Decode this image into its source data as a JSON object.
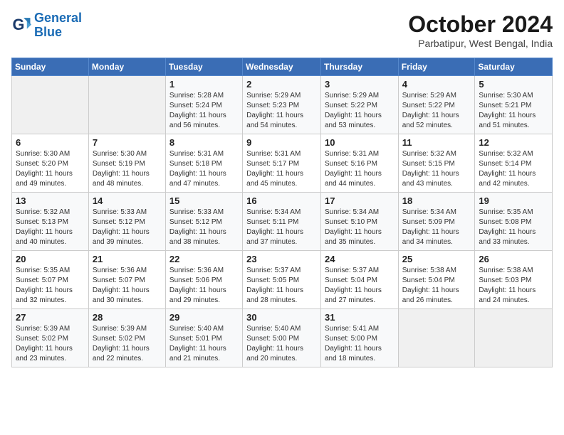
{
  "logo": {
    "line1": "General",
    "line2": "Blue"
  },
  "title": "October 2024",
  "location": "Parbatipur, West Bengal, India",
  "headers": [
    "Sunday",
    "Monday",
    "Tuesday",
    "Wednesday",
    "Thursday",
    "Friday",
    "Saturday"
  ],
  "weeks": [
    [
      {
        "day": "",
        "info": ""
      },
      {
        "day": "",
        "info": ""
      },
      {
        "day": "1",
        "info": "Sunrise: 5:28 AM\nSunset: 5:24 PM\nDaylight: 11 hours and 56 minutes."
      },
      {
        "day": "2",
        "info": "Sunrise: 5:29 AM\nSunset: 5:23 PM\nDaylight: 11 hours and 54 minutes."
      },
      {
        "day": "3",
        "info": "Sunrise: 5:29 AM\nSunset: 5:22 PM\nDaylight: 11 hours and 53 minutes."
      },
      {
        "day": "4",
        "info": "Sunrise: 5:29 AM\nSunset: 5:22 PM\nDaylight: 11 hours and 52 minutes."
      },
      {
        "day": "5",
        "info": "Sunrise: 5:30 AM\nSunset: 5:21 PM\nDaylight: 11 hours and 51 minutes."
      }
    ],
    [
      {
        "day": "6",
        "info": "Sunrise: 5:30 AM\nSunset: 5:20 PM\nDaylight: 11 hours and 49 minutes."
      },
      {
        "day": "7",
        "info": "Sunrise: 5:30 AM\nSunset: 5:19 PM\nDaylight: 11 hours and 48 minutes."
      },
      {
        "day": "8",
        "info": "Sunrise: 5:31 AM\nSunset: 5:18 PM\nDaylight: 11 hours and 47 minutes."
      },
      {
        "day": "9",
        "info": "Sunrise: 5:31 AM\nSunset: 5:17 PM\nDaylight: 11 hours and 45 minutes."
      },
      {
        "day": "10",
        "info": "Sunrise: 5:31 AM\nSunset: 5:16 PM\nDaylight: 11 hours and 44 minutes."
      },
      {
        "day": "11",
        "info": "Sunrise: 5:32 AM\nSunset: 5:15 PM\nDaylight: 11 hours and 43 minutes."
      },
      {
        "day": "12",
        "info": "Sunrise: 5:32 AM\nSunset: 5:14 PM\nDaylight: 11 hours and 42 minutes."
      }
    ],
    [
      {
        "day": "13",
        "info": "Sunrise: 5:32 AM\nSunset: 5:13 PM\nDaylight: 11 hours and 40 minutes."
      },
      {
        "day": "14",
        "info": "Sunrise: 5:33 AM\nSunset: 5:12 PM\nDaylight: 11 hours and 39 minutes."
      },
      {
        "day": "15",
        "info": "Sunrise: 5:33 AM\nSunset: 5:12 PM\nDaylight: 11 hours and 38 minutes."
      },
      {
        "day": "16",
        "info": "Sunrise: 5:34 AM\nSunset: 5:11 PM\nDaylight: 11 hours and 37 minutes."
      },
      {
        "day": "17",
        "info": "Sunrise: 5:34 AM\nSunset: 5:10 PM\nDaylight: 11 hours and 35 minutes."
      },
      {
        "day": "18",
        "info": "Sunrise: 5:34 AM\nSunset: 5:09 PM\nDaylight: 11 hours and 34 minutes."
      },
      {
        "day": "19",
        "info": "Sunrise: 5:35 AM\nSunset: 5:08 PM\nDaylight: 11 hours and 33 minutes."
      }
    ],
    [
      {
        "day": "20",
        "info": "Sunrise: 5:35 AM\nSunset: 5:07 PM\nDaylight: 11 hours and 32 minutes."
      },
      {
        "day": "21",
        "info": "Sunrise: 5:36 AM\nSunset: 5:07 PM\nDaylight: 11 hours and 30 minutes."
      },
      {
        "day": "22",
        "info": "Sunrise: 5:36 AM\nSunset: 5:06 PM\nDaylight: 11 hours and 29 minutes."
      },
      {
        "day": "23",
        "info": "Sunrise: 5:37 AM\nSunset: 5:05 PM\nDaylight: 11 hours and 28 minutes."
      },
      {
        "day": "24",
        "info": "Sunrise: 5:37 AM\nSunset: 5:04 PM\nDaylight: 11 hours and 27 minutes."
      },
      {
        "day": "25",
        "info": "Sunrise: 5:38 AM\nSunset: 5:04 PM\nDaylight: 11 hours and 26 minutes."
      },
      {
        "day": "26",
        "info": "Sunrise: 5:38 AM\nSunset: 5:03 PM\nDaylight: 11 hours and 24 minutes."
      }
    ],
    [
      {
        "day": "27",
        "info": "Sunrise: 5:39 AM\nSunset: 5:02 PM\nDaylight: 11 hours and 23 minutes."
      },
      {
        "day": "28",
        "info": "Sunrise: 5:39 AM\nSunset: 5:02 PM\nDaylight: 11 hours and 22 minutes."
      },
      {
        "day": "29",
        "info": "Sunrise: 5:40 AM\nSunset: 5:01 PM\nDaylight: 11 hours and 21 minutes."
      },
      {
        "day": "30",
        "info": "Sunrise: 5:40 AM\nSunset: 5:00 PM\nDaylight: 11 hours and 20 minutes."
      },
      {
        "day": "31",
        "info": "Sunrise: 5:41 AM\nSunset: 5:00 PM\nDaylight: 11 hours and 18 minutes."
      },
      {
        "day": "",
        "info": ""
      },
      {
        "day": "",
        "info": ""
      }
    ]
  ]
}
